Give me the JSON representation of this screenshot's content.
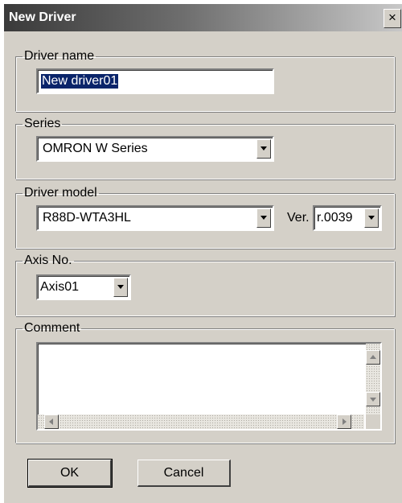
{
  "window": {
    "title": "New Driver",
    "close_glyph": "×"
  },
  "driver_name": {
    "legend": "Driver name",
    "value": "New driver01"
  },
  "series": {
    "legend": "Series",
    "selected": "OMRON W Series"
  },
  "driver_model": {
    "legend": "Driver model",
    "selected": "R88D-WTA3HL",
    "version_label": "Ver.",
    "version_selected": "r.0039"
  },
  "axis": {
    "legend": "Axis No.",
    "selected": "Axis01"
  },
  "comment": {
    "legend": "Comment",
    "value": ""
  },
  "buttons": {
    "ok": "OK",
    "cancel": "Cancel"
  },
  "icons": [
    "close-icon",
    "dropdown-arrow-icon",
    "scroll-up-icon",
    "scroll-down-icon",
    "scroll-left-icon",
    "scroll-right-icon"
  ]
}
